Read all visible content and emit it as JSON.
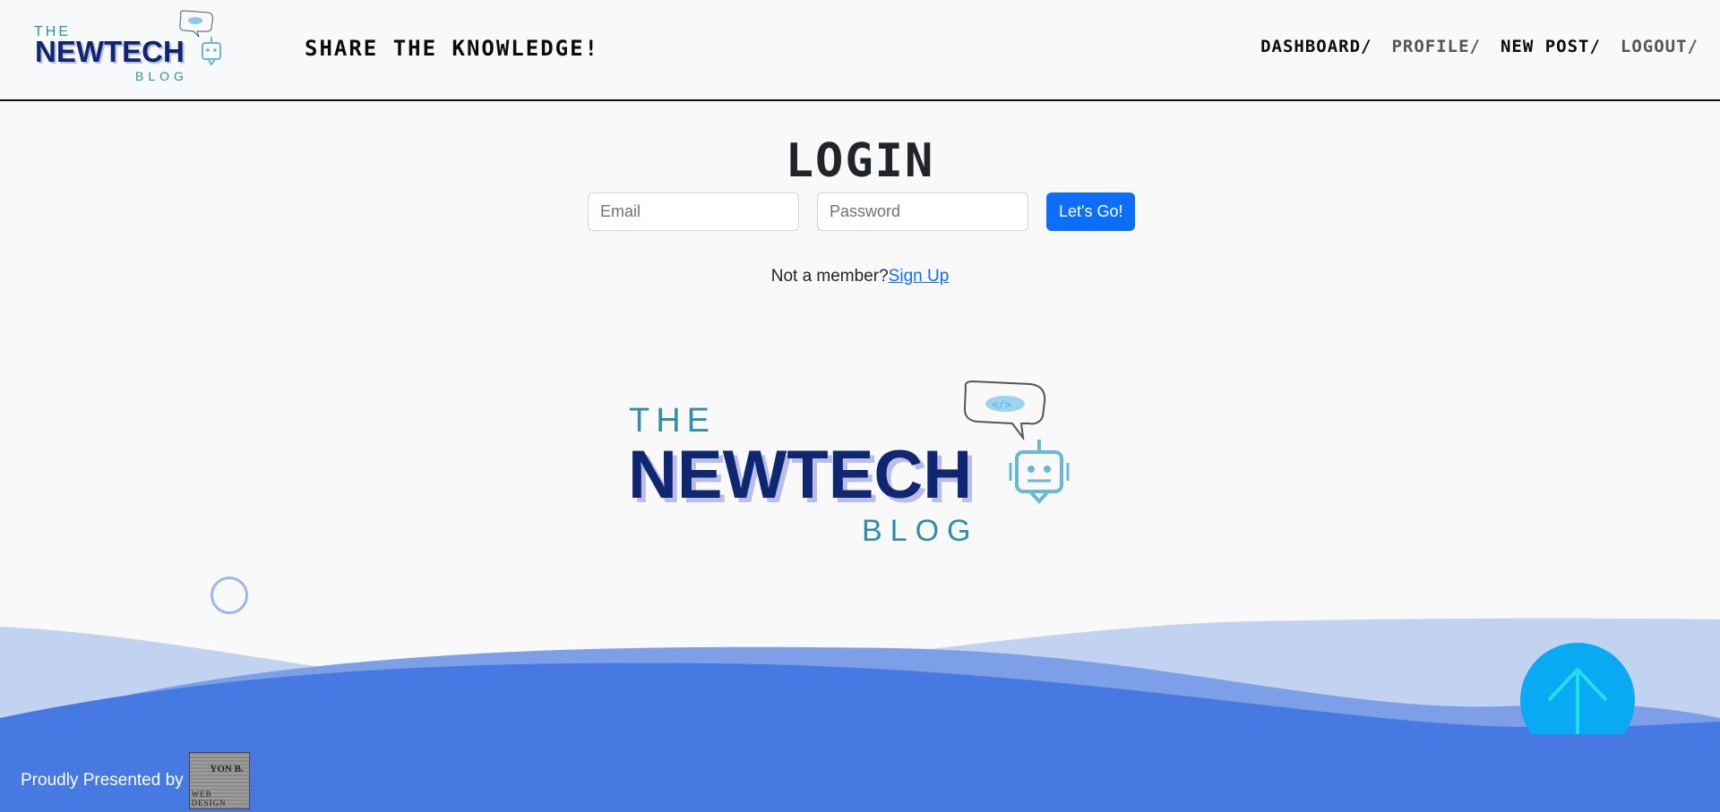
{
  "header": {
    "logo": {
      "the": "THE",
      "name": "NEWTECH",
      "blog": "BLOG"
    },
    "tagline": "SHARE THE KNOWLEDGE!",
    "nav": [
      {
        "label": "DASHBOARD/"
      },
      {
        "label": "PROFILE/"
      },
      {
        "label": "NEW POST/"
      },
      {
        "label": "LOGOUT/"
      }
    ]
  },
  "login": {
    "title": "LOGIN",
    "email": {
      "placeholder": "Email",
      "value": ""
    },
    "password": {
      "placeholder": "Password",
      "value": ""
    },
    "submit_label": "Let's Go!",
    "prompt": "Not a member?",
    "signup_link": "Sign Up"
  },
  "hero_logo": {
    "the": "THE",
    "name": "NEWTECH",
    "blog": "BLOG"
  },
  "footer": {
    "credit_text": "Proudly Presented by",
    "badge_line1": "YON B.",
    "badge_line2": "WEB DESIGN"
  },
  "colors": {
    "primary_button": "#0d6efd",
    "wave_light": "#c2d3f2",
    "wave_mid": "#7c9fe8",
    "wave_dark": "#4779e2",
    "scroll_top": "#0aa9f4",
    "logo_navy": "#0f2670",
    "logo_teal": "#2f8fa8"
  },
  "icons": {
    "scroll_top": "arrow-up-icon",
    "logo_mascot": "robot-chat-icon"
  }
}
